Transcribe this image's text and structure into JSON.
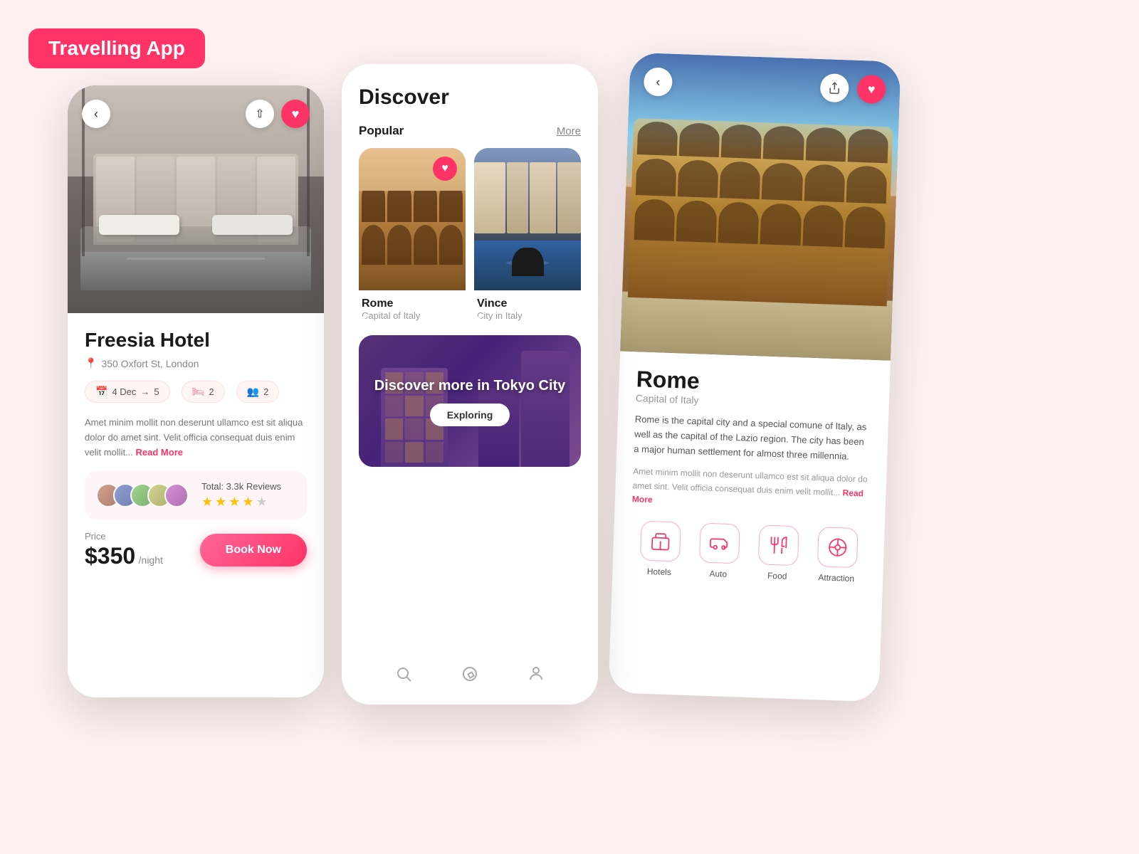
{
  "app": {
    "label": "Travelling App"
  },
  "card1": {
    "hotel_name": "Freesia Hotel",
    "location": "350 Oxfort St, London",
    "check_in": "4 Dec",
    "check_out": "5",
    "rooms": "2",
    "guests": "2",
    "description": "Amet minim mollit non deserunt ullamco est sit aliqua dolor do amet sint. Velit officia consequat duis enim velit mollit...",
    "read_more": "Read More",
    "reviews_total": "Total: 3.3k Reviews",
    "price_label": "Price",
    "price": "$350",
    "per_night": "/night",
    "book_btn": "Book Now",
    "stars": 4,
    "max_stars": 5
  },
  "card2": {
    "title": "Discover",
    "popular_label": "Popular",
    "more_link": "More",
    "place1_name": "Rome",
    "place1_sub": "Capital of Italy",
    "place2_name": "Vince",
    "place2_sub": "City in Italy",
    "banner_text": "Discover more in Tokyo City",
    "exploring_btn": "Exploring"
  },
  "card3": {
    "city_name": "Rome",
    "subtitle": "Capital of Italy",
    "desc1": "Rome is the capital city and a special comune of Italy, as well as the capital of the Lazio region. The city has been a major human settlement for almost three millennia.",
    "desc2": "Amet minim mollit non deserunt ullamco est sit aliqua dolor do amet sint. Velit officia consequat duis enim velit mollit...",
    "read_more": "Read More",
    "categories": [
      {
        "label": "Hotels",
        "icon": "🏨"
      },
      {
        "label": "Auto",
        "icon": "🚗"
      },
      {
        "label": "Food",
        "icon": "🍽️"
      },
      {
        "label": "Attraction",
        "icon": "🎡"
      }
    ]
  }
}
